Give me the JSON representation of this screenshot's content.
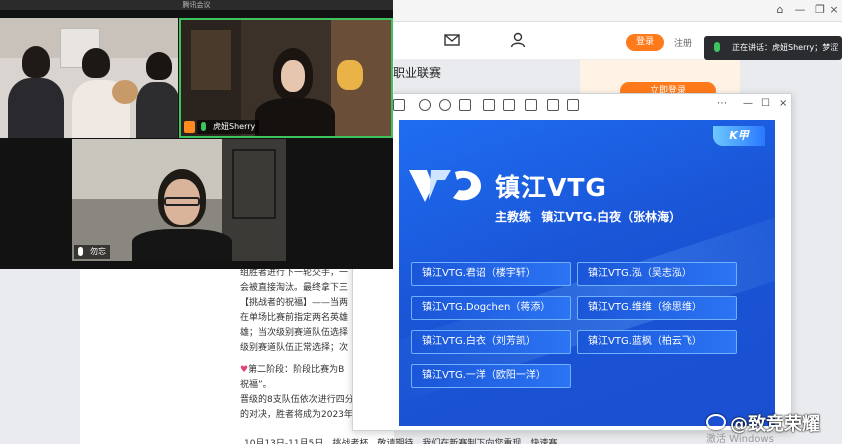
{
  "conference": {
    "title": "腾讯会议",
    "participants": [
      {
        "name": "",
        "active": false
      },
      {
        "name": "虎妞Sherry",
        "active": true,
        "host": true
      },
      {
        "name": "勿忘",
        "active": false
      }
    ]
  },
  "browser": {
    "heading": "职业联赛",
    "login_label": "登录",
    "register_label": "注册",
    "ad_button_label": "立即登录"
  },
  "speaking_indicator": "正在讲话：虎妞Sherry；梦涩",
  "article": {
    "lines": [
      "组胜者进行下一轮交手，一",
      "会被直接淘汰。最终拿下三",
      "【挑战者的祝福】——当两",
      "在单场比赛前指定两名英雄",
      "雄；当次级别赛道队伍选择",
      "级别赛道队伍正常选择；次"
    ],
    "stage2_lines": [
      "第二阶段：阶段比赛为B",
      "祝福”。",
      "晋级的8支队伍依次进行四分",
      "的对决，胜者将成为2023年"
    ],
    "bottom_line": "10月13日-11月5日，挑战者杯，敬请期待，我们在新赛制下向您重现，快速赛"
  },
  "poster": {
    "badge": "K甲",
    "team_name": "镇江VTG",
    "coach_label": "主教练",
    "coach_name": "镇江VTG.白夜（张林海）",
    "players": [
      "镇江VTG.君诏（楼宇轩）",
      "镇江VTG.泓（吴志泓）",
      "镇江VTG.Dogchen（蒋添）",
      "镇江VTG.维维（徐思维）",
      "镇江VTG.白衣（刘芳凯）",
      "镇江VTG.蓝枫（柏云飞）",
      "镇江VTG.一洋（欧阳一洋）"
    ]
  },
  "watermark": {
    "weibo": "@致竞荣耀",
    "activate": "激活 Windows"
  },
  "colors": {
    "accent_orange": "#ff7a1a",
    "speaking_green": "#3ec35f",
    "poster_blue": "#1a55d6"
  }
}
